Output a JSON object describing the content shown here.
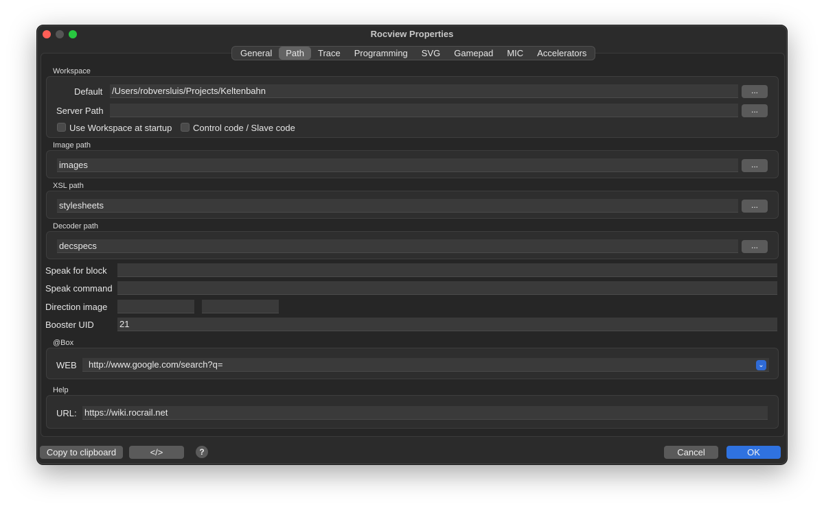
{
  "window": {
    "title": "Rocview Properties"
  },
  "tabs": [
    "General",
    "Path",
    "Trace",
    "Programming",
    "SVG",
    "Gamepad",
    "MIC",
    "Accelerators"
  ],
  "active_tab": "Path",
  "workspace": {
    "group_label": "Workspace",
    "default_label": "Default",
    "default_value": "/Users/robversluis/Projects/Keltenbahn",
    "server_path_label": "Server Path",
    "server_path_value": "",
    "browse_label": "...",
    "use_workspace_label": "Use Workspace at startup",
    "control_code_label": "Control code / Slave code"
  },
  "image_path": {
    "group_label": "Image path",
    "value": "images",
    "browse_label": "..."
  },
  "xsl_path": {
    "group_label": "XSL path",
    "value": "stylesheets",
    "browse_label": "..."
  },
  "decoder_path": {
    "group_label": "Decoder path",
    "value": "decspecs",
    "browse_label": "..."
  },
  "speak_for_block": {
    "label": "Speak for block",
    "value": ""
  },
  "speak_command": {
    "label": "Speak command",
    "value": ""
  },
  "direction_image": {
    "label": "Direction image",
    "value1": "",
    "value2": ""
  },
  "booster_uid": {
    "label": "Booster UID",
    "value": "21"
  },
  "box": {
    "group_label": "@Box",
    "web_label": "WEB",
    "web_value": "http://www.google.com/search?q="
  },
  "help": {
    "group_label": "Help",
    "url_label": "URL:",
    "url_value": "https://wiki.rocrail.net"
  },
  "footer": {
    "copy_label": "Copy to clipboard",
    "code_label": "</>",
    "help_label": "?",
    "cancel_label": "Cancel",
    "ok_label": "OK"
  },
  "colors": {
    "accent": "#2f72e0",
    "window_bg": "#2b2b2b"
  }
}
